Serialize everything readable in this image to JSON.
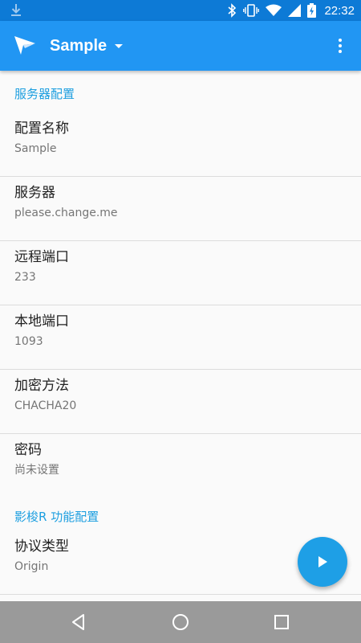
{
  "status_bar": {
    "time": "22:32",
    "icons": [
      "download-icon",
      "bluetooth-icon",
      "vibrate-icon",
      "wifi-icon",
      "signal-icon",
      "battery-charging-icon"
    ]
  },
  "app_bar": {
    "title": "Sample",
    "logo_icon": "paper-plane-icon",
    "menu_icon": "more-vert-icon",
    "background": "#2196f3"
  },
  "sections": {
    "server_config": {
      "header": "服务器配置",
      "items": [
        {
          "title": "配置名称",
          "value": "Sample"
        },
        {
          "title": "服务器",
          "value": "please.change.me"
        },
        {
          "title": "远程端口",
          "value": "233"
        },
        {
          "title": "本地端口",
          "value": "1093"
        },
        {
          "title": "加密方法",
          "value": "CHACHA20"
        },
        {
          "title": "密码",
          "value": "尚未设置"
        }
      ]
    },
    "feature_config": {
      "header": "影梭R 功能配置",
      "items": [
        {
          "title": "协议类型",
          "value": "Origin"
        }
      ]
    }
  },
  "fab": {
    "icon": "play-icon",
    "color": "#1e9fe6"
  },
  "nav_bar": {
    "back_icon": "back-triangle-icon",
    "home_icon": "home-circle-icon",
    "recents_icon": "recents-square-icon"
  },
  "accent_color": "#1e9fe0"
}
